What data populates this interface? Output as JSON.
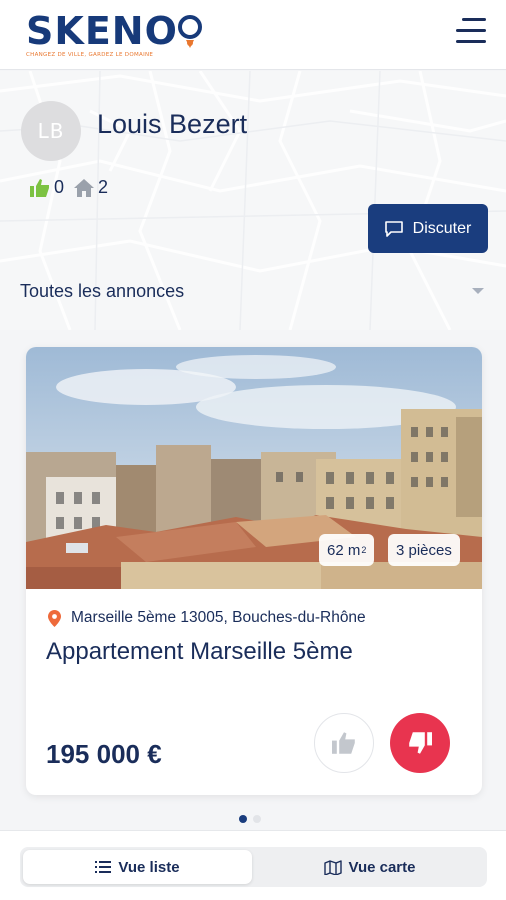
{
  "header": {
    "logo_text": "SKENO",
    "logo_tagline": "CHANGEZ DE VILLE, GARDEZ LE DOMAINE",
    "menu_icon": "hamburger-menu-icon"
  },
  "profile": {
    "avatar_initials": "LB",
    "name": "Louis Bezert",
    "likes_count": "0",
    "homes_count": "2",
    "chat_button_label": "Discuter"
  },
  "filter": {
    "selected": "Toutes les annonces"
  },
  "listing": {
    "area_value": "62 m",
    "area_unit_sup": "2",
    "rooms_label": "3 pièces",
    "location": "Marseille 5ème 13005, Bouches-du-Rhône",
    "title": "Appartement Marseille 5ème",
    "price": "195 000 €"
  },
  "pagination": {
    "total": 2,
    "active_index": 0
  },
  "view_toggle": {
    "list_label": "Vue liste",
    "map_label": "Vue carte",
    "selected": "list"
  },
  "colors": {
    "brand_navy": "#1a3d7e",
    "brand_orange": "#e9772f",
    "like_green": "#7cc242",
    "dislike_red": "#e8344f"
  }
}
